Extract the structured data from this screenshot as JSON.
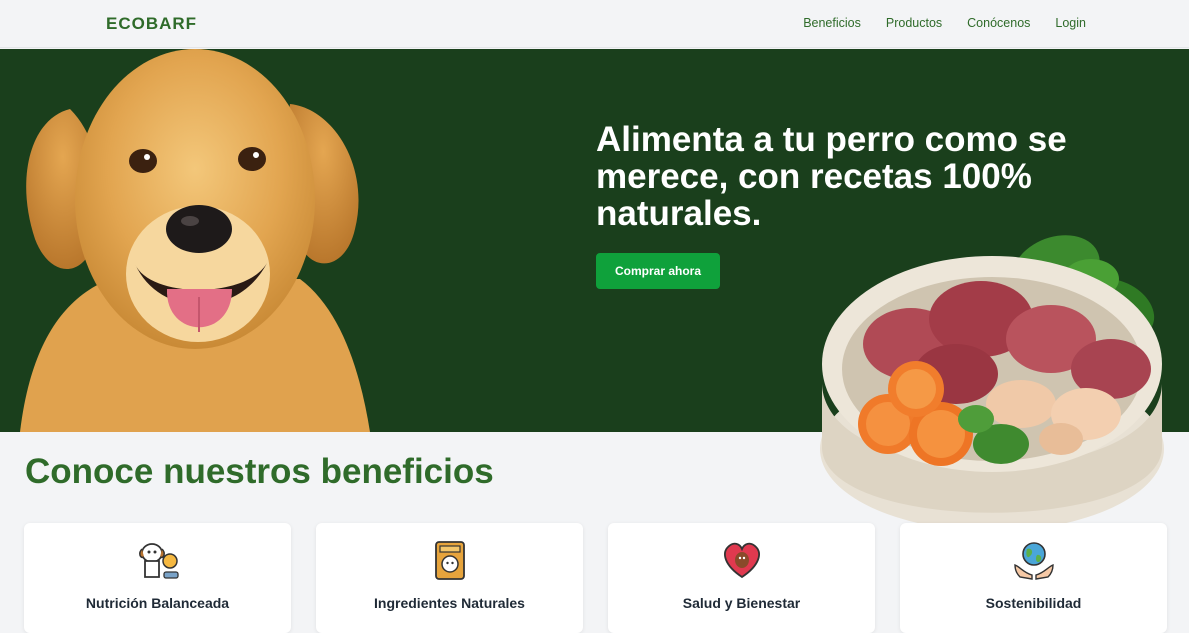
{
  "brand": {
    "name": "ECOBARF"
  },
  "nav": {
    "items": [
      "Beneficios",
      "Productos",
      "Conócenos",
      "Login"
    ]
  },
  "hero": {
    "title": "Alimenta a tu perro como se merece, con recetas 100% naturales.",
    "cta": "Comprar ahora"
  },
  "benefits": {
    "heading": "Conoce nuestros beneficios",
    "cards": [
      {
        "title": "Nutrición Balanceada",
        "icon": "dog-bone-icon"
      },
      {
        "title": "Ingredientes Naturales",
        "icon": "food-bag-icon"
      },
      {
        "title": "Salud y Bienestar",
        "icon": "heart-dog-icon"
      },
      {
        "title": "Sostenibilidad",
        "icon": "globe-hands-icon"
      }
    ]
  },
  "colors": {
    "brand": "#2f6b2a",
    "hero_bg": "#1a3f1c",
    "cta": "#0fa13b"
  }
}
